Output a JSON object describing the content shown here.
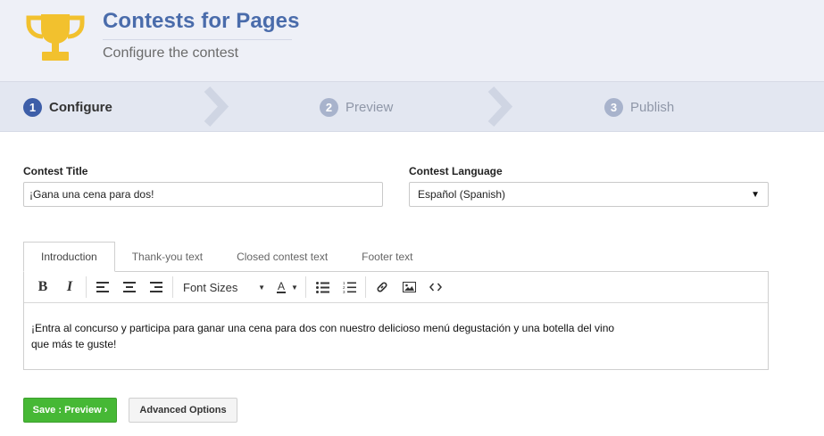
{
  "header": {
    "title": "Contests for Pages",
    "subtitle": "Configure the contest",
    "icon": "trophy-icon",
    "colors": {
      "title": "#4a6cab",
      "trophy": "#f2c12e",
      "background": "#eef0f7"
    }
  },
  "steps": [
    {
      "number": "1",
      "label": "Configure",
      "active": true
    },
    {
      "number": "2",
      "label": "Preview",
      "active": false
    },
    {
      "number": "3",
      "label": "Publish",
      "active": false
    }
  ],
  "form": {
    "contest_title_label": "Contest Title",
    "contest_title_value": "¡Gana una cena para dos!",
    "contest_language_label": "Contest Language",
    "contest_language_value": "Español (Spanish)"
  },
  "tabs": [
    {
      "label": "Introduction",
      "active": true
    },
    {
      "label": "Thank-you text",
      "active": false
    },
    {
      "label": "Closed contest text",
      "active": false
    },
    {
      "label": "Footer text",
      "active": false
    }
  ],
  "toolbar": {
    "bold": "B",
    "italic": "I",
    "font_sizes": "Font Sizes",
    "text_color": "A",
    "icons": [
      "bold-icon",
      "italic-icon",
      "align-left-icon",
      "align-center-icon",
      "align-right-icon",
      "font-size-dropdown",
      "text-color-icon",
      "bullet-list-icon",
      "numbered-list-icon",
      "link-icon",
      "image-icon",
      "code-icon"
    ]
  },
  "editor": {
    "content": "¡Entra al concurso y participa para ganar una cena para dos con nuestro delicioso menú degustación y una botella del vino que más te guste!"
  },
  "buttons": {
    "save_preview": "Save : Preview ›",
    "advanced_options": "Advanced Options",
    "colors": {
      "save": "#46b835"
    }
  }
}
